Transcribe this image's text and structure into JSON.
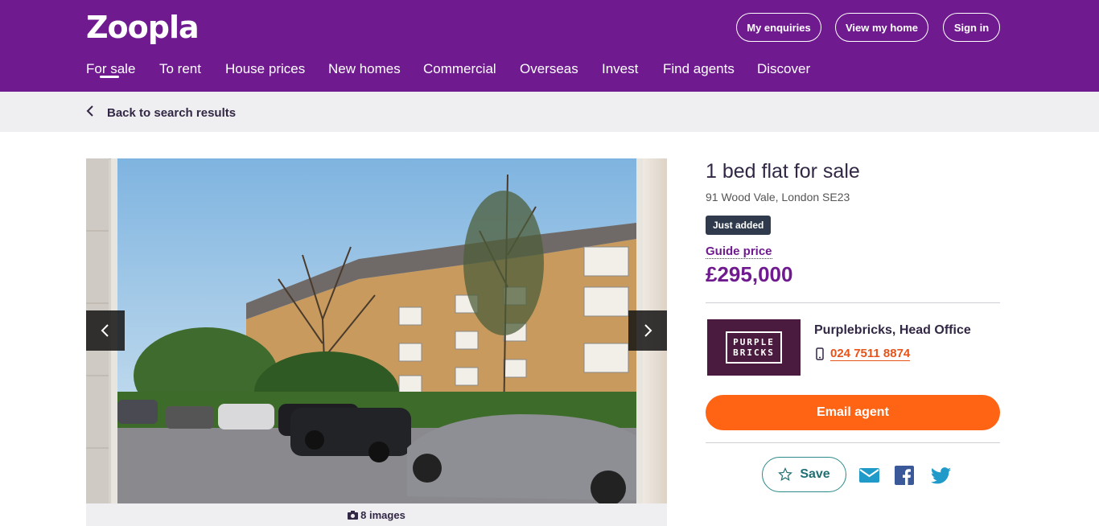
{
  "header": {
    "logo": "Zoopla",
    "buttons": [
      "My enquiries",
      "View my home",
      "Sign in"
    ],
    "nav": [
      "For sale",
      "To rent",
      "House prices",
      "New homes",
      "Commercial",
      "Overseas",
      "Invest",
      "Find agents",
      "Discover"
    ],
    "active_nav": "For sale"
  },
  "subbar": {
    "back_label": "Back to search results",
    "back_icon": "chevron-left-icon"
  },
  "gallery": {
    "image_count_label": "8 images",
    "count_icon": "camera-icon",
    "prev_icon": "chevron-left-icon",
    "next_icon": "chevron-right-icon"
  },
  "listing": {
    "title": "1 bed flat for sale",
    "address": "91 Wood Vale, London SE23",
    "badge": "Just added",
    "price_label": "Guide price",
    "price": "£295,000"
  },
  "agent": {
    "logo_text_line1": "PURPLE",
    "logo_text_line2": "BRICKS",
    "name": "Purplebricks, Head Office",
    "phone": "024 7511 8874",
    "phone_icon": "mobile-phone-icon"
  },
  "actions": {
    "email_label": "Email agent",
    "save_label": "Save",
    "save_icon": "star-icon",
    "share_icons": [
      "email-icon",
      "facebook-icon",
      "twitter-icon"
    ]
  },
  "colors": {
    "brand_purple": "#6f1b8f",
    "accent_orange": "#ff6414",
    "teal": "#1f6f73",
    "badge_bg": "#2f3b4c"
  }
}
